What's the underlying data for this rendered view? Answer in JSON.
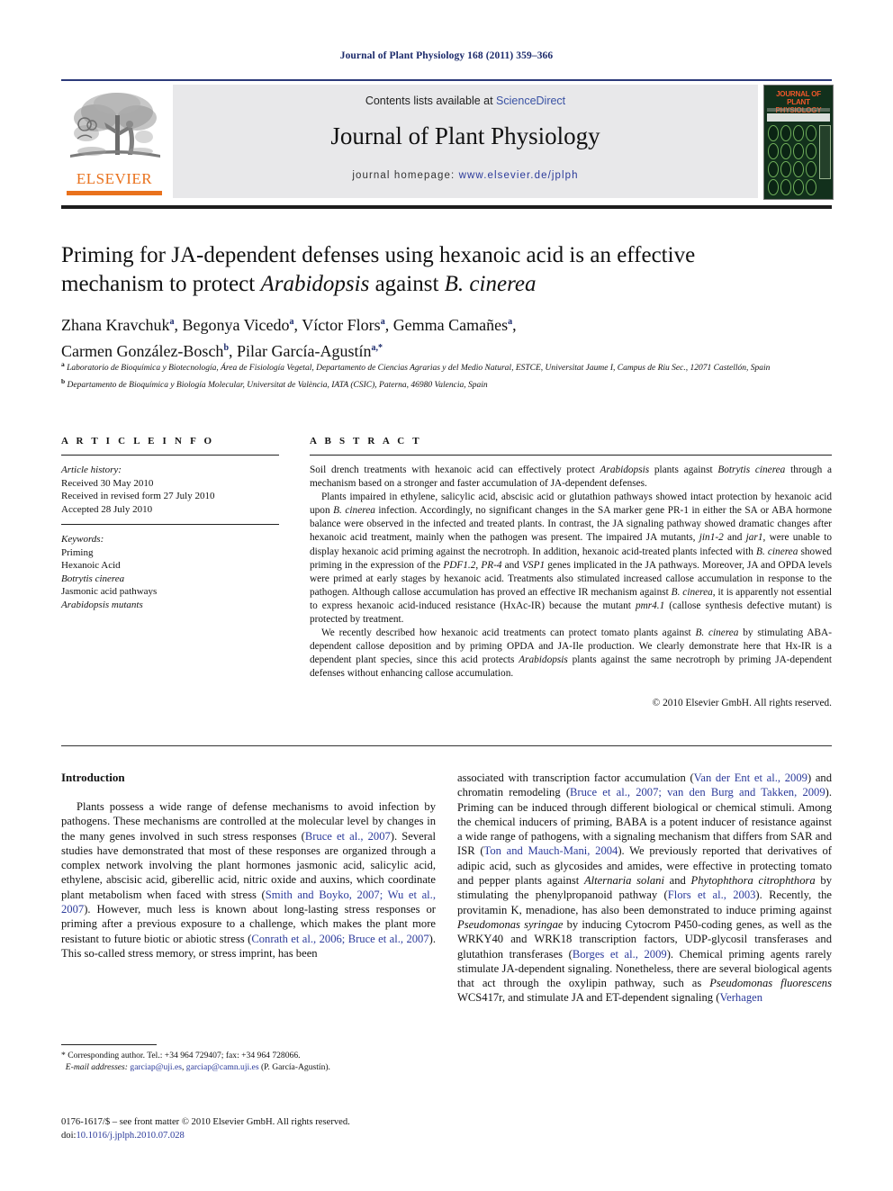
{
  "running_head": "Journal of Plant Physiology 168 (2011) 359–366",
  "masthead": {
    "contents_prefix": "Contents lists available at ",
    "sciencedirect": "ScienceDirect",
    "journal_name": "Journal of Plant Physiology",
    "homepage_prefix": "journal homepage: ",
    "homepage_url": "www.elsevier.de/jplph",
    "publisher_wordmark": "ELSEVIER",
    "cover_title": "JOURNAL OF PLANT PHYSIOLOGY",
    "accent_orange": "#E9711C",
    "accent_blue": "#2b3a9a",
    "band_gray": "#e8e8ea"
  },
  "article": {
    "title_line1": "Priming for JA-dependent defenses using hexanoic acid is an effective",
    "title_line2_a": "mechanism to protect ",
    "title_line2_italic1": "Arabidopsis",
    "title_line2_b": " against ",
    "title_line2_italic2": "B. cinerea",
    "authors_line1": "Zhana Kravchuk",
    "authors_line1_sup1": "a",
    "authors_line1_b": ", Begonya Vicedo",
    "authors_line1_sup2": "a",
    "authors_line1_c": ", Víctor Flors",
    "authors_line1_sup3": "a",
    "authors_line1_d": ", Gemma Camañes",
    "authors_line1_sup4": "a",
    "authors_line1_e": ",",
    "authors_line2_a": "Carmen González-Bosch",
    "authors_line2_sup1": "b",
    "authors_line2_b": ", Pilar García-Agustín",
    "authors_line2_sup2": "a,*",
    "affiliation_a_marker": "a",
    "affiliation_a": "Laboratorio de Bioquímica y Biotecnología, Área de Fisiología Vegetal, Departamento de Ciencias Agrarias y del Medio Natural, ESTCE, Universitat Jaume I, Campus de Riu Sec., 12071 Castellón, Spain",
    "affiliation_b_marker": "b",
    "affiliation_b": "Departamento de Bioquímica y Biología Molecular, Universitat de València, IATA (CSIC), Paterna, 46980 Valencia, Spain"
  },
  "info": {
    "heading": "A R T I C L E    I N F O",
    "history_label": "Article history:",
    "history": [
      "Received 30 May 2010",
      "Received in revised form 27 July 2010",
      "Accepted 28 July 2010"
    ],
    "keywords_label": "Keywords:",
    "keywords": [
      "Priming",
      "Hexanoic Acid",
      "Botrytis cinerea",
      "Jasmonic acid pathways",
      "Arabidopsis mutants"
    ]
  },
  "abstract": {
    "heading": "A B S T R A C T",
    "p1_a": "Soil drench treatments with hexanoic acid can effectively protect ",
    "p1_i1": "Arabidopsis",
    "p1_b": " plants against ",
    "p1_i2": "Botrytis cinerea",
    "p1_c": " through a mechanism based on a stronger and faster accumulation of JA-dependent defenses.",
    "p2_a": "Plants impaired in ethylene, salicylic acid, abscisic acid or glutathion pathways showed intact protection by hexanoic acid upon ",
    "p2_i1": "B. cinerea",
    "p2_b": " infection. Accordingly, no significant changes in the SA marker gene PR-1 in either the SA or ABA hormone balance were observed in the infected and treated plants. In contrast, the JA signaling pathway showed dramatic changes after hexanoic acid treatment, mainly when the pathogen was present. The impaired JA mutants, ",
    "p2_i2": "jin1-2",
    "p2_c": " and ",
    "p2_i3": "jar1",
    "p2_d": ", were unable to display hexanoic acid priming against the necrotroph. In addition, hexanoic acid-treated plants infected with ",
    "p2_i4": "B. cinerea",
    "p2_e": " showed priming in the expression of the ",
    "p2_i5": "PDF1.2",
    "p2_f": ", ",
    "p2_i6": "PR-4",
    "p2_g": " and ",
    "p2_i7": "VSP1",
    "p2_h": " genes implicated in the JA pathways. Moreover, JA and OPDA levels were primed at early stages by hexanoic acid. Treatments also stimulated increased callose accumulation in response to the pathogen. Although callose accumulation has proved an effective IR mechanism against ",
    "p2_i8": "B. cinerea",
    "p2_i": ", it is apparently not essential to express hexanoic acid-induced resistance (HxAc-IR) because the mutant ",
    "p2_i9": "pmr4.1",
    "p2_j": " (callose synthesis defective mutant) is protected by treatment.",
    "p3_a": "We recently described how hexanoic acid treatments can protect tomato plants against ",
    "p3_i1": "B. cinerea",
    "p3_b": " by stimulating ABA-dependent callose deposition and by priming OPDA and JA-Ile production. We clearly demonstrate here that Hx-IR is a dependent plant species, since this acid protects ",
    "p3_i2": "Arabidopsis",
    "p3_c": " plants against the same necrotroph by priming JA-dependent defenses without enhancing callose accumulation.",
    "copyright": "© 2010 Elsevier GmbH. All rights reserved."
  },
  "introduction": {
    "heading": "Introduction",
    "left_a": "Plants possess a wide range of defense mechanisms to avoid infection by pathogens. These mechanisms are controlled at the molecular level by changes in the many genes involved in such stress responses (",
    "left_cite1": "Bruce et al., 2007",
    "left_b": "). Several studies have demonstrated that most of these responses are organized through a complex network involving the plant hormones jasmonic acid, salicylic acid, ethylene, abscisic acid, giberellic acid, nitric oxide and auxins, which coordinate plant metabolism when faced with stress (",
    "left_cite2": "Smith and Boyko, 2007; Wu et al., 2007",
    "left_c": "). However, much less is known about long-lasting stress responses or priming after a previous exposure to a challenge, which makes the plant more resistant to future biotic or abiotic stress (",
    "left_cite3": "Conrath et al., 2006; Bruce et al., 2007",
    "left_d": "). This so-called stress memory, or stress imprint, has been",
    "right_a": "associated with transcription factor accumulation (",
    "right_cite1": "Van der Ent et al., 2009",
    "right_b": ") and chromatin remodeling (",
    "right_cite2": "Bruce et al., 2007; van den Burg and Takken, 2009",
    "right_c": "). Priming can be induced through different biological or chemical stimuli. Among the chemical inducers of priming, BABA is a potent inducer of resistance against a wide range of pathogens, with a signaling mechanism that differs from SAR and ISR (",
    "right_cite3": "Ton and Mauch-Mani, 2004",
    "right_d": "). We previously reported that derivatives of adipic acid, such as glycosides and amides, were effective in protecting tomato and pepper plants against ",
    "right_i1": "Alternaria solani",
    "right_e": " and ",
    "right_i2": "Phytophthora citrophthora",
    "right_f": " by stimulating the phenylpropanoid pathway (",
    "right_cite4": "Flors et al., 2003",
    "right_g": "). Recently, the provitamin K, menadione, has also been demonstrated to induce priming against ",
    "right_i3": "Pseudomonas syringae",
    "right_h": " by inducing Cytocrom P450-coding genes, as well as the WRKY40 and WRK18 transcription factors, UDP-glycosil transferases and glutathion transferases (",
    "right_cite5": "Borges et al., 2009",
    "right_i": "). Chemical priming agents rarely stimulate JA-dependent signaling. Nonetheless, there are several biological agents that act through the oxylipin pathway, such as ",
    "right_i4": "Pseudomonas fluorescens",
    "right_j": " WCS417r, and stimulate JA and ET-dependent signaling (",
    "right_cite6": "Verhagen"
  },
  "footnote": {
    "marker": "*",
    "corresponding": " Corresponding author. Tel.: +34 964 729407; fax: +34 964 728066.",
    "email_label": "E-mail addresses:",
    "email1": "garciap@uji.es",
    "email_sep": ", ",
    "email2": "garciap@camn.uji.es",
    "email_suffix": " (P. García-Agustín)."
  },
  "imprint": {
    "line1": "0176-1617/$ – see front matter © 2010 Elsevier GmbH. All rights reserved.",
    "doi_label": "doi:",
    "doi_value": "10.1016/j.jplph.2010.07.028"
  }
}
